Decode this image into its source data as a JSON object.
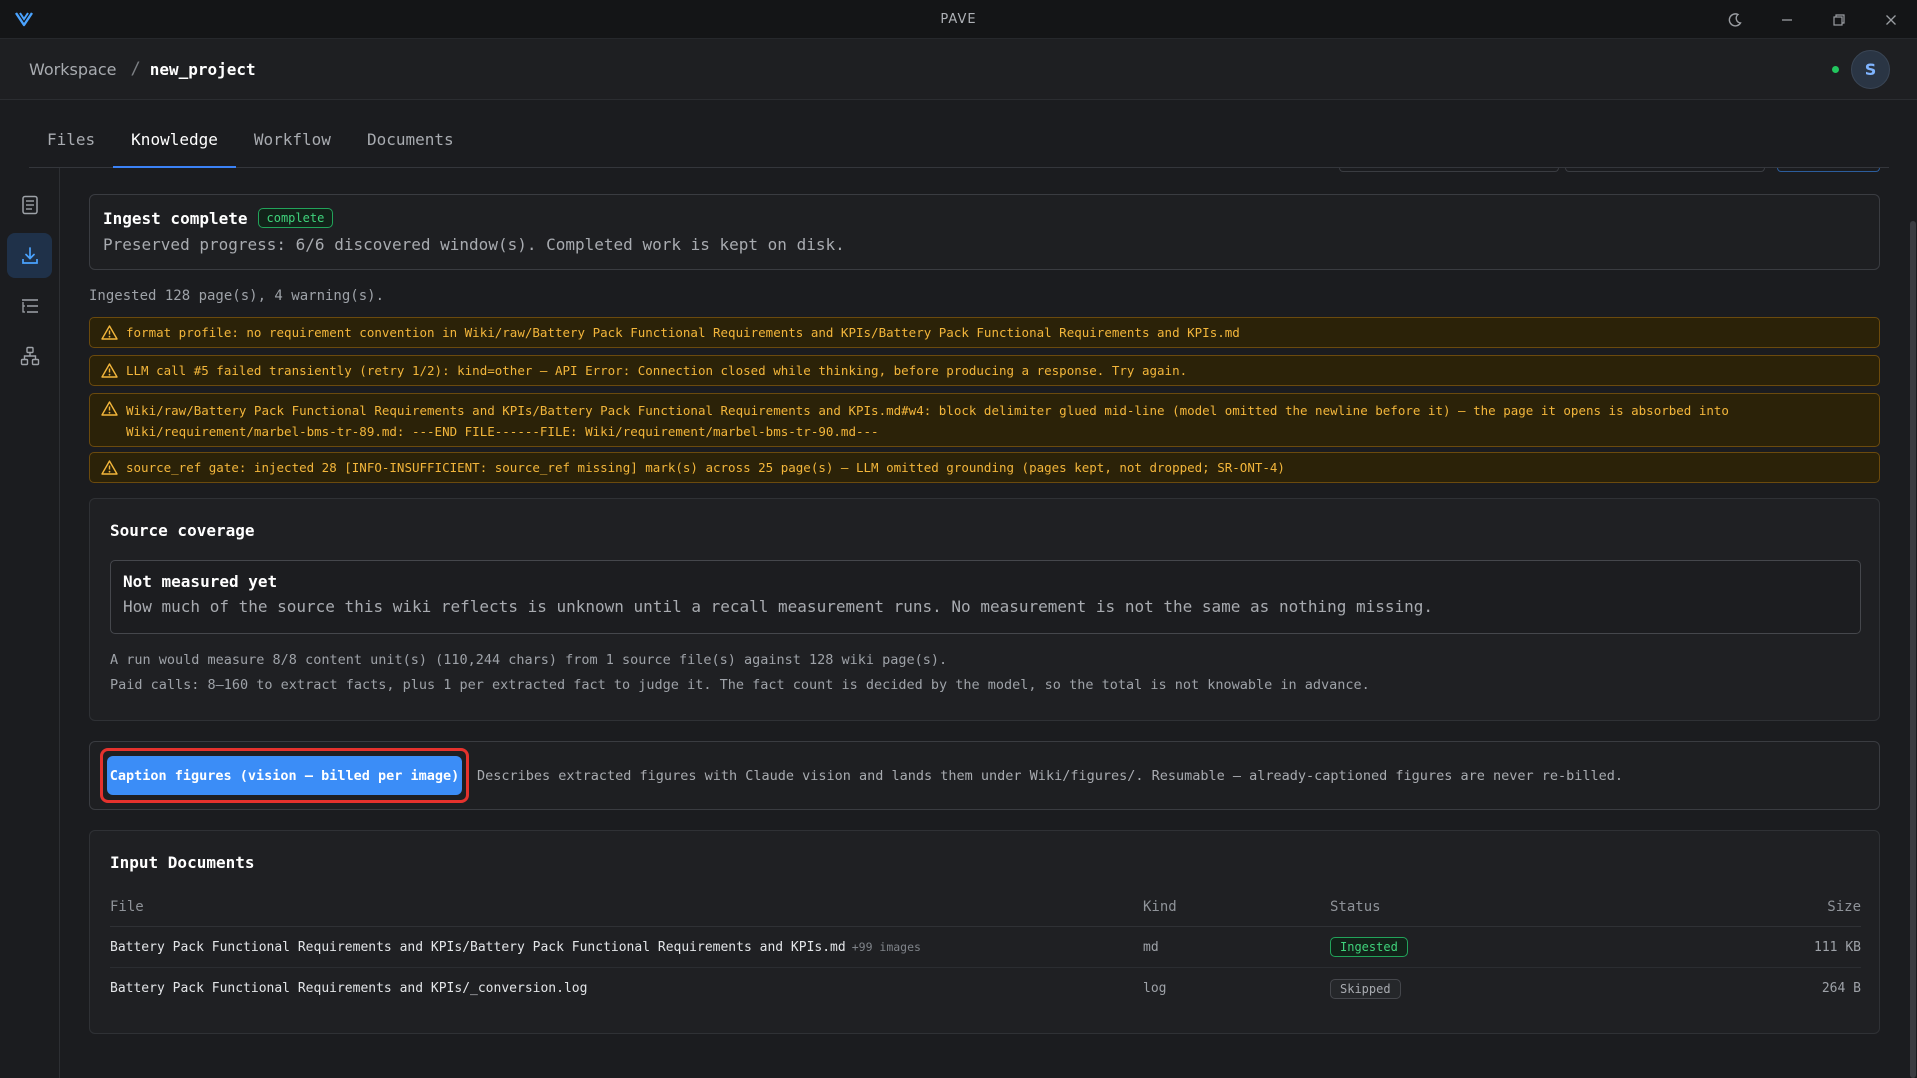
{
  "window": {
    "title": "PAVE",
    "colors": {
      "accent": "#3b82f6",
      "success": "#22c55e",
      "warning": "#f3b63b",
      "highlight": "#e5322d"
    }
  },
  "breadcrumb": {
    "root": "Workspace",
    "separator": "/",
    "current": "new_project"
  },
  "user": {
    "avatar_letter": "S",
    "online": true
  },
  "tabs": [
    {
      "label": "Files",
      "active": false
    },
    {
      "label": "Knowledge",
      "active": true
    },
    {
      "label": "Workflow",
      "active": false
    },
    {
      "label": "Documents",
      "active": false
    }
  ],
  "sidebar": {
    "items": [
      {
        "icon": "document-icon",
        "active": false
      },
      {
        "icon": "download-icon",
        "active": true
      },
      {
        "icon": "list-icon",
        "active": false
      },
      {
        "icon": "hierarchy-icon",
        "active": false
      }
    ]
  },
  "ingest": {
    "title": "Ingest complete",
    "badge": "complete",
    "description": "Preserved progress: 6/6 discovered window(s). Completed work is kept on disk."
  },
  "summary": "Ingested 128 page(s), 4 warning(s).",
  "warnings": [
    "format profile: no requirement convention in Wiki/raw/Battery Pack Functional Requirements and KPIs/Battery Pack Functional Requirements and KPIs.md",
    "LLM call #5 failed transiently (retry 1/2): kind=other — API Error: Connection closed while thinking, before producing a response. Try again.",
    "Wiki/raw/Battery Pack Functional Requirements and KPIs/Battery Pack Functional Requirements and KPIs.md#w4: block delimiter glued mid-line (model omitted the newline before it) — the page it opens is absorbed into Wiki/requirement/marbel-bms-tr-89.md: ---END FILE------FILE: Wiki/requirement/marbel-bms-tr-90.md---",
    "source_ref gate: injected 28 [INFO-INSUFFICIENT: source_ref missing] mark(s) across 25 page(s) — LLM omitted grounding (pages kept, not dropped; SR-ONT-4)"
  ],
  "coverage": {
    "title": "Source coverage",
    "status_title": "Not measured yet",
    "status_desc": "How much of the source this wiki reflects is unknown until a recall measurement runs. No measurement is not the same as nothing missing.",
    "note1": "A run would measure 8/8 content unit(s) (110,244 chars) from 1 source file(s) against 128 wiki page(s).",
    "note2": "Paid calls: 8–160 to extract facts, plus 1 per extracted fact to judge it. The fact count is decided by the model, so the total is not knowable in advance."
  },
  "caption": {
    "button_label": "Caption figures (vision — billed per image)",
    "description": "Describes extracted figures with Claude vision and lands them under Wiki/figures/. Resumable — already-captioned figures are never re-billed."
  },
  "documents": {
    "title": "Input Documents",
    "columns": {
      "file": "File",
      "kind": "Kind",
      "status": "Status",
      "size": "Size"
    },
    "rows": [
      {
        "file": "Battery Pack Functional Requirements and KPIs/Battery Pack Functional Requirements and KPIs.md",
        "extra": "+99 images",
        "kind": "md",
        "status": "Ingested",
        "size": "111 KB"
      },
      {
        "file": "Battery Pack Functional Requirements and KPIs/_conversion.log",
        "extra": "",
        "kind": "log",
        "status": "Skipped",
        "size": "264 B"
      }
    ]
  }
}
